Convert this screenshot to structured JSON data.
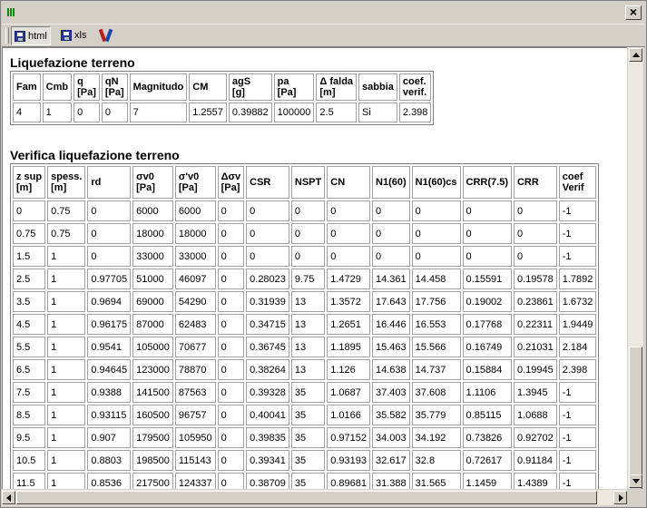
{
  "toolbar": {
    "html_label": "html",
    "xls_label": "xls"
  },
  "section1": {
    "title": "Liquefazione terreno",
    "headers": [
      "Fam",
      "Cmb",
      "q\n[Pa]",
      "qN\n[Pa]",
      "Magnitudo",
      "CM",
      "agS\n[g]",
      "pa\n[Pa]",
      "Δ falda\n[m]",
      "sabbia",
      "coef.\nverif."
    ],
    "row": [
      "4",
      "1",
      "0",
      "0",
      "7",
      "1.2557",
      "0.39882",
      "100000",
      "2.5",
      "Si",
      "2.398"
    ]
  },
  "section2": {
    "title": "Verifica liquefazione terreno",
    "headers": [
      "z sup\n[m]",
      "spess.\n[m]",
      "rd",
      "σv0\n[Pa]",
      "σ'v0\n[Pa]",
      "Δσv\n[Pa]",
      "CSR",
      "NSPT",
      "CN",
      "N1(60)",
      "N1(60)cs",
      "CRR(7.5)",
      "CRR",
      "coef\nVerif"
    ],
    "rows": [
      [
        "0",
        "0.75",
        "0",
        "6000",
        "6000",
        "0",
        "0",
        "0",
        "0",
        "0",
        "0",
        "0",
        "0",
        "-1"
      ],
      [
        "0.75",
        "0.75",
        "0",
        "18000",
        "18000",
        "0",
        "0",
        "0",
        "0",
        "0",
        "0",
        "0",
        "0",
        "-1"
      ],
      [
        "1.5",
        "1",
        "0",
        "33000",
        "33000",
        "0",
        "0",
        "0",
        "0",
        "0",
        "0",
        "0",
        "0",
        "-1"
      ],
      [
        "2.5",
        "1",
        "0.97705",
        "51000",
        "46097",
        "0",
        "0.28023",
        "9.75",
        "1.4729",
        "14.361",
        "14.458",
        "0.15591",
        "0.19578",
        "1.7892"
      ],
      [
        "3.5",
        "1",
        "0.9694",
        "69000",
        "54290",
        "0",
        "0.31939",
        "13",
        "1.3572",
        "17.643",
        "17.756",
        "0.19002",
        "0.23861",
        "1.6732"
      ],
      [
        "4.5",
        "1",
        "0.96175",
        "87000",
        "62483",
        "0",
        "0.34715",
        "13",
        "1.2651",
        "16.446",
        "16.553",
        "0.17768",
        "0.22311",
        "1.9449"
      ],
      [
        "5.5",
        "1",
        "0.9541",
        "105000",
        "70677",
        "0",
        "0.36745",
        "13",
        "1.1895",
        "15.463",
        "15.566",
        "0.16749",
        "0.21031",
        "2.184"
      ],
      [
        "6.5",
        "1",
        "0.94645",
        "123000",
        "78870",
        "0",
        "0.38264",
        "13",
        "1.126",
        "14.638",
        "14.737",
        "0.15884",
        "0.19945",
        "2.398"
      ],
      [
        "7.5",
        "1",
        "0.9388",
        "141500",
        "87563",
        "0",
        "0.39328",
        "35",
        "1.0687",
        "37.403",
        "37.608",
        "1.1106",
        "1.3945",
        "-1"
      ],
      [
        "8.5",
        "1",
        "0.93115",
        "160500",
        "96757",
        "0",
        "0.40041",
        "35",
        "1.0166",
        "35.582",
        "35.779",
        "0.85115",
        "1.0688",
        "-1"
      ],
      [
        "9.5",
        "1",
        "0.907",
        "179500",
        "105950",
        "0",
        "0.39835",
        "35",
        "0.97152",
        "34.003",
        "34.192",
        "0.73826",
        "0.92702",
        "-1"
      ],
      [
        "10.5",
        "1",
        "0.8803",
        "198500",
        "115143",
        "0",
        "0.39341",
        "35",
        "0.93193",
        "32.617",
        "32.8",
        "0.72617",
        "0.91184",
        "-1"
      ],
      [
        "11.5",
        "1",
        "0.8536",
        "217500",
        "124337",
        "0",
        "0.38709",
        "35",
        "0.89681",
        "31.388",
        "31.565",
        "1.1459",
        "1.4389",
        "-1"
      ]
    ]
  }
}
